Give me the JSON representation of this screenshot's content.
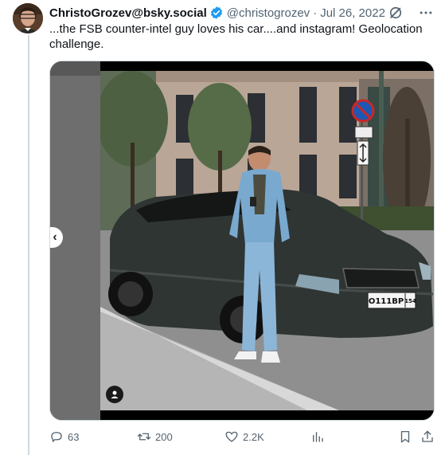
{
  "tweet": {
    "author_name": "ChristoGrozev@bsky.social",
    "handle": "@christogrozev",
    "separator": "·",
    "date": "Jul 26, 2022",
    "text": "...the FSB counter-intel guy loves his car....and instagram! Geolocation challenge.",
    "plate_number": "О111ВР",
    "plate_region": "154"
  },
  "actions": {
    "replies": "63",
    "reposts": "200",
    "likes": "2.2K"
  },
  "media": {
    "prev_arrow": "‹"
  },
  "colors": {
    "muted": "#536471",
    "verified": "#1d9bf0",
    "text": "#0f1419",
    "divider": "#cfd9de"
  },
  "icons": [
    "verified-badge-icon",
    "grok-icon",
    "more-options-icon",
    "reply-icon",
    "repost-icon",
    "like-icon",
    "views-icon",
    "bookmark-icon",
    "share-icon",
    "person-tag-icon"
  ]
}
